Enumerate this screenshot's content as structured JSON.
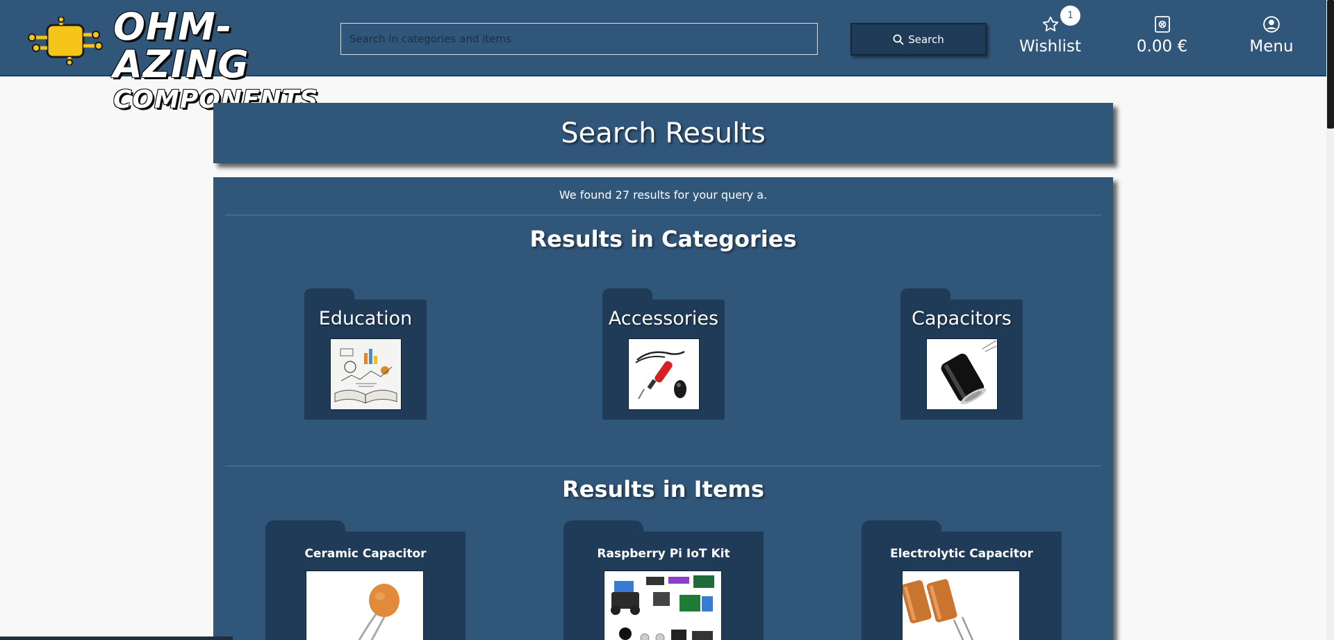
{
  "header": {
    "logo": {
      "line1": "OHM-AZING",
      "line2": "COMPONENTS"
    },
    "search": {
      "placeholder": "Search in categories and items",
      "value": "",
      "button_label": "Search"
    },
    "wishlist": {
      "label": "Wishlist",
      "count": "1",
      "icon": "star-icon"
    },
    "cart": {
      "label": "0.00 €",
      "icon": "cart-icon"
    },
    "menu": {
      "label": "Menu",
      "icon": "user-circle-icon"
    }
  },
  "page": {
    "title": "Search Results",
    "summary": "We found 27 results for your query a."
  },
  "categories": {
    "heading": "Results in Categories",
    "items": [
      {
        "label": "Education",
        "image": "books-illustration"
      },
      {
        "label": "Accessories",
        "image": "soldering-iron"
      },
      {
        "label": "Capacitors",
        "image": "capacitor"
      }
    ]
  },
  "items": {
    "heading": "Results in Items",
    "list": [
      {
        "label": "Ceramic Capacitor",
        "image": "ceramic-capacitor"
      },
      {
        "label": "Raspberry Pi IoT Kit",
        "image": "robot-kit"
      },
      {
        "label": "Electrolytic Capacitor",
        "image": "electrolytic-capacitor"
      }
    ]
  },
  "colors": {
    "primary": "#30567a",
    "primary_dark": "#1f3b57",
    "logo_yellow": "#f5c518",
    "background": "#f8f8f8"
  }
}
